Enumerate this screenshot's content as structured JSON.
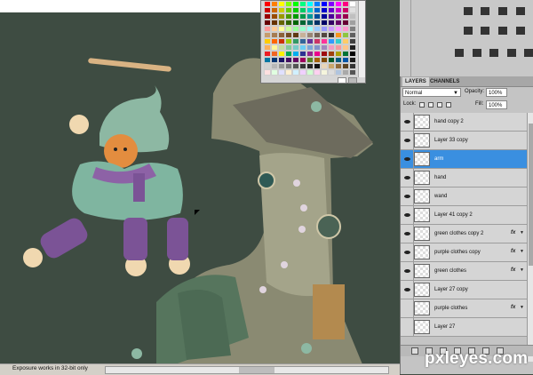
{
  "layers_panel": {
    "tabs": [
      {
        "label": "LAYERS"
      },
      {
        "label": "CHANNELS"
      }
    ],
    "blend_mode": "Normal",
    "opacity_label": "Opacity:",
    "opacity_value": "100%",
    "lock_label": "Lock:",
    "fill_label": "Fill:",
    "fill_value": "100%",
    "layers": [
      {
        "name": "hand copy 2",
        "fx": false,
        "selected": false,
        "visible": true
      },
      {
        "name": "Layer 33 copy",
        "fx": false,
        "selected": false,
        "visible": true
      },
      {
        "name": "arm",
        "fx": false,
        "selected": true,
        "visible": true
      },
      {
        "name": "hand",
        "fx": false,
        "selected": false,
        "visible": true
      },
      {
        "name": "wand",
        "fx": false,
        "selected": false,
        "visible": true
      },
      {
        "name": "Layer 41 copy 2",
        "fx": false,
        "selected": false,
        "visible": true
      },
      {
        "name": "green clothes copy 2",
        "fx": true,
        "selected": false,
        "visible": true
      },
      {
        "name": "purple clothes copy",
        "fx": true,
        "selected": false,
        "visible": true
      },
      {
        "name": "green clothes",
        "fx": true,
        "selected": false,
        "visible": true
      },
      {
        "name": "Layer 27 copy",
        "fx": false,
        "selected": false,
        "visible": true
      },
      {
        "name": "purple clothes",
        "fx": true,
        "selected": false,
        "visible": false
      },
      {
        "name": "Layer 27",
        "fx": false,
        "selected": false,
        "visible": false
      }
    ],
    "fx_label": "fx"
  },
  "status_bar": {
    "text": "Exposure works in 32-bit only"
  },
  "watermark": {
    "text": "pxleyes.com"
  },
  "swatches": {
    "colors": [
      "#ff0000",
      "#ff8000",
      "#ffff00",
      "#80ff00",
      "#00ff00",
      "#00ff80",
      "#00ffff",
      "#0080ff",
      "#0000ff",
      "#8000ff",
      "#ff00ff",
      "#ff0080",
      "#ffffff",
      "#cc0000",
      "#cc6600",
      "#cccc00",
      "#66cc00",
      "#00cc00",
      "#00cc66",
      "#00cccc",
      "#0066cc",
      "#0000cc",
      "#6600cc",
      "#cc00cc",
      "#cc0066",
      "#e0e0e0",
      "#990000",
      "#994c00",
      "#999900",
      "#4c9900",
      "#009900",
      "#00994c",
      "#009999",
      "#004c99",
      "#000099",
      "#4c0099",
      "#990099",
      "#99004c",
      "#c0c0c0",
      "#660000",
      "#663300",
      "#666600",
      "#336600",
      "#006600",
      "#006633",
      "#006666",
      "#003366",
      "#000066",
      "#330066",
      "#660066",
      "#660033",
      "#a0a0a0",
      "#ff9999",
      "#ffcc99",
      "#ffff99",
      "#ccff99",
      "#99ff99",
      "#99ffcc",
      "#99ffff",
      "#99ccff",
      "#9999ff",
      "#cc99ff",
      "#ff99ff",
      "#ff99cc",
      "#808080",
      "#c69c6d",
      "#a67c52",
      "#8c6239",
      "#754c24",
      "#603913",
      "#c7b299",
      "#998675",
      "#736357",
      "#534741",
      "#362f2d",
      "#f7941d",
      "#8dc63f",
      "#606060",
      "#ffcc00",
      "#ff6600",
      "#cc3300",
      "#99cc00",
      "#339966",
      "#336699",
      "#663399",
      "#cc3366",
      "#ff3399",
      "#3399ff",
      "#33cccc",
      "#ffcc66",
      "#404040",
      "#fbaf5d",
      "#fff799",
      "#c4df9b",
      "#82ca9c",
      "#7accc8",
      "#6dcff6",
      "#7da7d9",
      "#8393ca",
      "#a187be",
      "#f49ac2",
      "#f6989d",
      "#fdc68a",
      "#202020",
      "#ed1c24",
      "#f26522",
      "#fff200",
      "#00a651",
      "#00aeef",
      "#2e3192",
      "#92278f",
      "#ec008c",
      "#9e0b0f",
      "#a0410d",
      "#aba000",
      "#007236",
      "#000000",
      "#0076a3",
      "#003471",
      "#1b1464",
      "#440e62",
      "#630460",
      "#9e005d",
      "#598527",
      "#a36209",
      "#7d4900",
      "#005826",
      "#005b7f",
      "#0054a6",
      "#1a1a1a",
      "#d2d2d2",
      "#b7b7b7",
      "#959595",
      "#7a7a7a",
      "#545454",
      "#363636",
      "#262626",
      "#111111",
      "#e8d5b7",
      "#c9a66b",
      "#8f6a3a",
      "#5b4322",
      "#333333",
      "#ffe0e0",
      "#e0ffe0",
      "#e0e0ff",
      "#fff0d0",
      "#d0f0ff",
      "#f0d0ff",
      "#d0ffd0",
      "#ffd0f0",
      "#f5f5dc",
      "#dcdcdc",
      "#b0c4de",
      "#a9a9a9",
      "#555555"
    ]
  }
}
